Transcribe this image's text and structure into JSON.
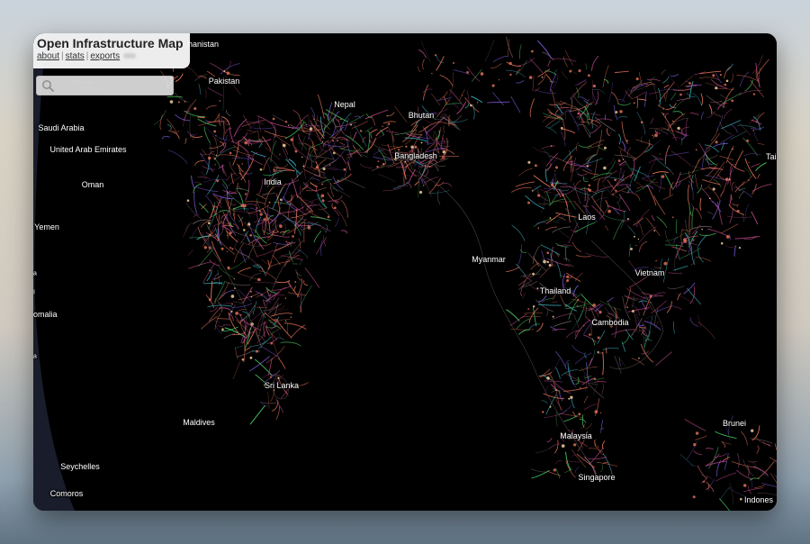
{
  "app": {
    "title": "Open Infrastructure Map",
    "links": [
      "about",
      "stats",
      "exports"
    ]
  },
  "search": {
    "placeholder": "",
    "value": ""
  },
  "map": {
    "basemap": "dark",
    "countries": [
      "hanistan",
      "Pakistan",
      "Nepal",
      "Bhutan",
      "Saudi Arabia",
      "United Arab Emirates",
      "Bangladesh",
      "Oman",
      "India",
      "Yemen",
      "Laos",
      "Myanmar",
      "Vietnam",
      "Thailand",
      "Cambodia",
      "omalia",
      "Sri Lanka",
      "Maldives",
      "Brunei",
      "Malaysia",
      "Seychelles",
      "Singapore",
      "Comoros",
      "Indones",
      "Tai"
    ],
    "colors": {
      "background": "#000000",
      "power_low": "#e8745a",
      "power_mid": "#c04a8c",
      "power_high": "#7a57d6",
      "power_hv": "#3fb9c9",
      "power_green": "#4fd36a",
      "land_border": "#6a5a5a"
    }
  }
}
